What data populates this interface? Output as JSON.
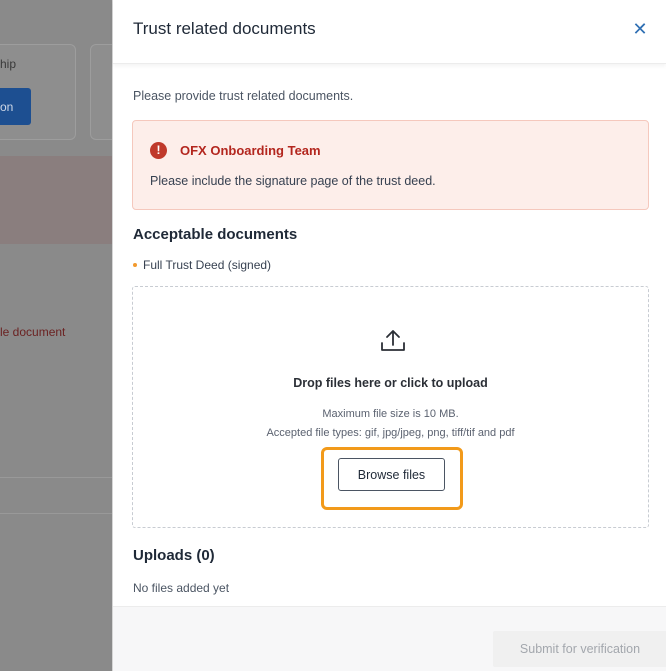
{
  "background": {
    "card_text_fragment": "hip",
    "button_text_fragment": "on",
    "document_text_fragment": "le document"
  },
  "drawer": {
    "title": "Trust related documents",
    "close_icon": "close-icon",
    "intro": "Please provide trust related documents.",
    "alert": {
      "icon": "exclamation-icon",
      "title": "OFX Onboarding Team",
      "message": "Please include the signature page of the trust deed."
    },
    "acceptable": {
      "heading": "Acceptable documents",
      "items": [
        "Full Trust Deed (signed)"
      ]
    },
    "dropzone": {
      "icon": "upload-icon",
      "title": "Drop files here or click to upload",
      "max_size": "Maximum file size is 10 MB.",
      "file_types": "Accepted file types: gif, jpg/jpeg, png, tiff/tif and pdf",
      "browse_label": "Browse files"
    },
    "uploads": {
      "heading": "Uploads (0)",
      "empty": "No files added yet"
    },
    "footer": {
      "submit_label": "Submit for verification"
    }
  },
  "colors": {
    "accent": "#2f6fb3",
    "alert_bg": "#fdeeea",
    "alert_text": "#b3261e",
    "highlight": "#f29a1a"
  }
}
